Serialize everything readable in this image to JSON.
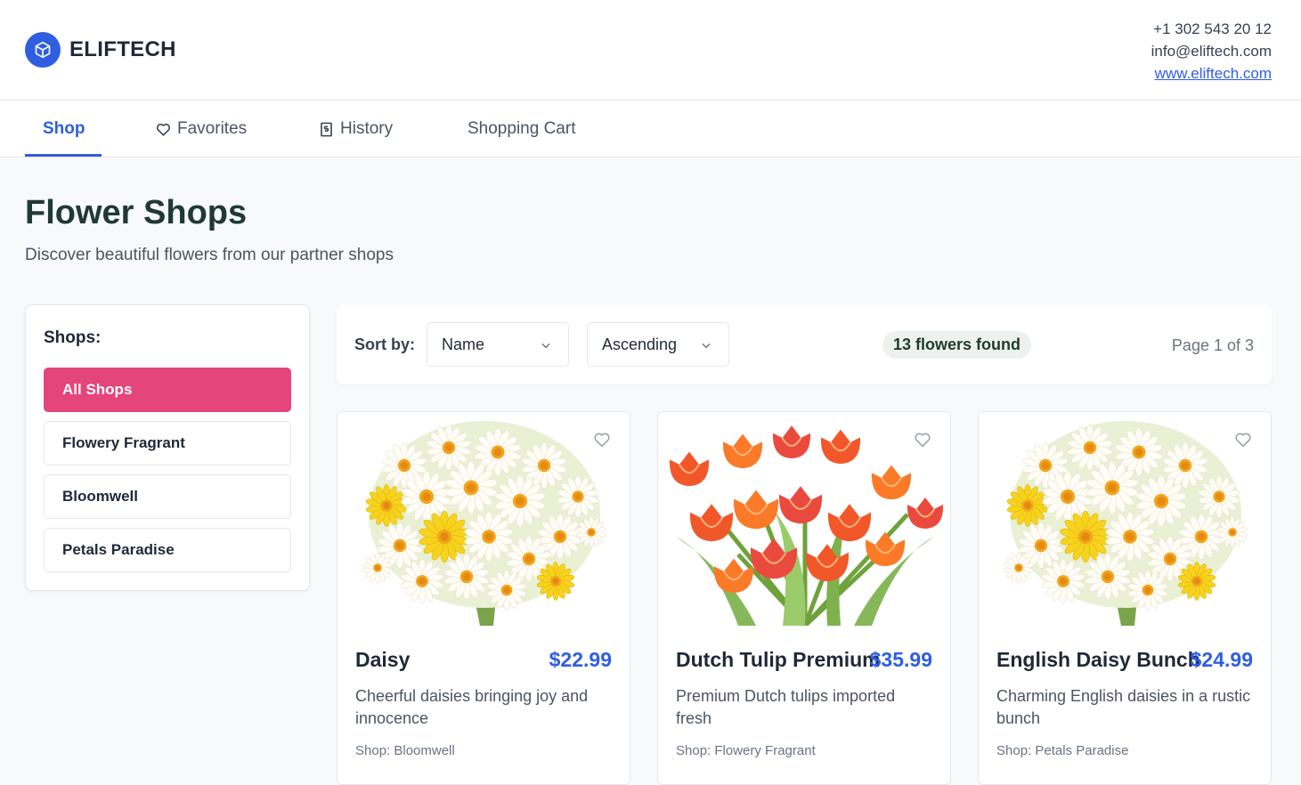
{
  "brand": {
    "name": "ELIFTECH",
    "color": "#2f5ee0",
    "icon": "cube-icon"
  },
  "contact": {
    "phone": "+1 302 543 20 12",
    "email": "info@eliftech.com",
    "website": "www.eliftech.com"
  },
  "nav": {
    "tabs": [
      {
        "label": "Shop",
        "active": true
      },
      {
        "label": "Favorites",
        "icon": "heart-icon"
      },
      {
        "label": "History",
        "icon": "receipt-icon"
      },
      {
        "label": "Shopping Cart"
      }
    ]
  },
  "page": {
    "title": "Flower Shops",
    "subtitle": "Discover beautiful flowers from our partner shops"
  },
  "sidebar": {
    "title": "Shops:",
    "shops": [
      {
        "label": "All Shops",
        "active": true
      },
      {
        "label": "Flowery Fragrant"
      },
      {
        "label": "Bloomwell"
      },
      {
        "label": "Petals Paradise"
      }
    ],
    "active_color": "#e4457a"
  },
  "toolbar": {
    "sort_label": "Sort by:",
    "sort_field": "Name",
    "sort_order": "Ascending",
    "found": "13 flowers found",
    "page_info": "Page 1 of 3"
  },
  "products": [
    {
      "name": "Daisy",
      "price": "$22.99",
      "description": "Cheerful daisies bringing joy and innocence",
      "shop": "Shop: Bloomwell",
      "image": "daisy"
    },
    {
      "name": "Dutch Tulip Premium",
      "price": "$35.99",
      "description": "Premium Dutch tulips imported fresh",
      "shop": "Shop: Flowery Fragrant",
      "image": "tulip"
    },
    {
      "name": "English Daisy Bunch",
      "price": "$24.99",
      "description": "Charming English daisies in a rustic bunch",
      "shop": "Shop: Petals Paradise",
      "image": "daisy"
    }
  ]
}
